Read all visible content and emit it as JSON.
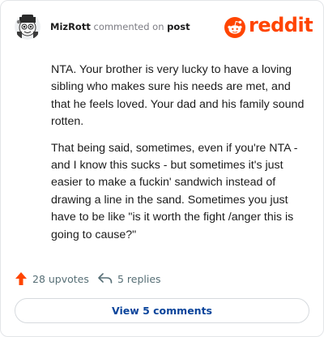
{
  "brand": {
    "logo_text": "reddit",
    "accent_color": "#ff4500",
    "icon": "reddit-snoo-icon"
  },
  "comment": {
    "author": "MizRott",
    "action_text": "commented on",
    "target_text": "post",
    "avatar_icon": "user-avatar-icon",
    "paragraphs": [
      "NTA. Your brother is very lucky to have a loving sibling who makes sure his needs are met, and that he feels loved. Your dad and his family sound rotten.",
      "That being said, sometimes, even if you're NTA - and I know this sucks - but sometimes it's just easier to make a fuckin' sandwich instead of drawing a line in the sand. Sometimes you just have to be like \"is it worth the fight /anger this is going to cause?\""
    ]
  },
  "actions": {
    "upvotes_label": "28 upvotes",
    "upvote_icon": "arrow-up-icon",
    "replies_label": "5 replies",
    "reply_icon": "reply-arrow-icon"
  },
  "view_button": {
    "label": "View 5 comments"
  }
}
